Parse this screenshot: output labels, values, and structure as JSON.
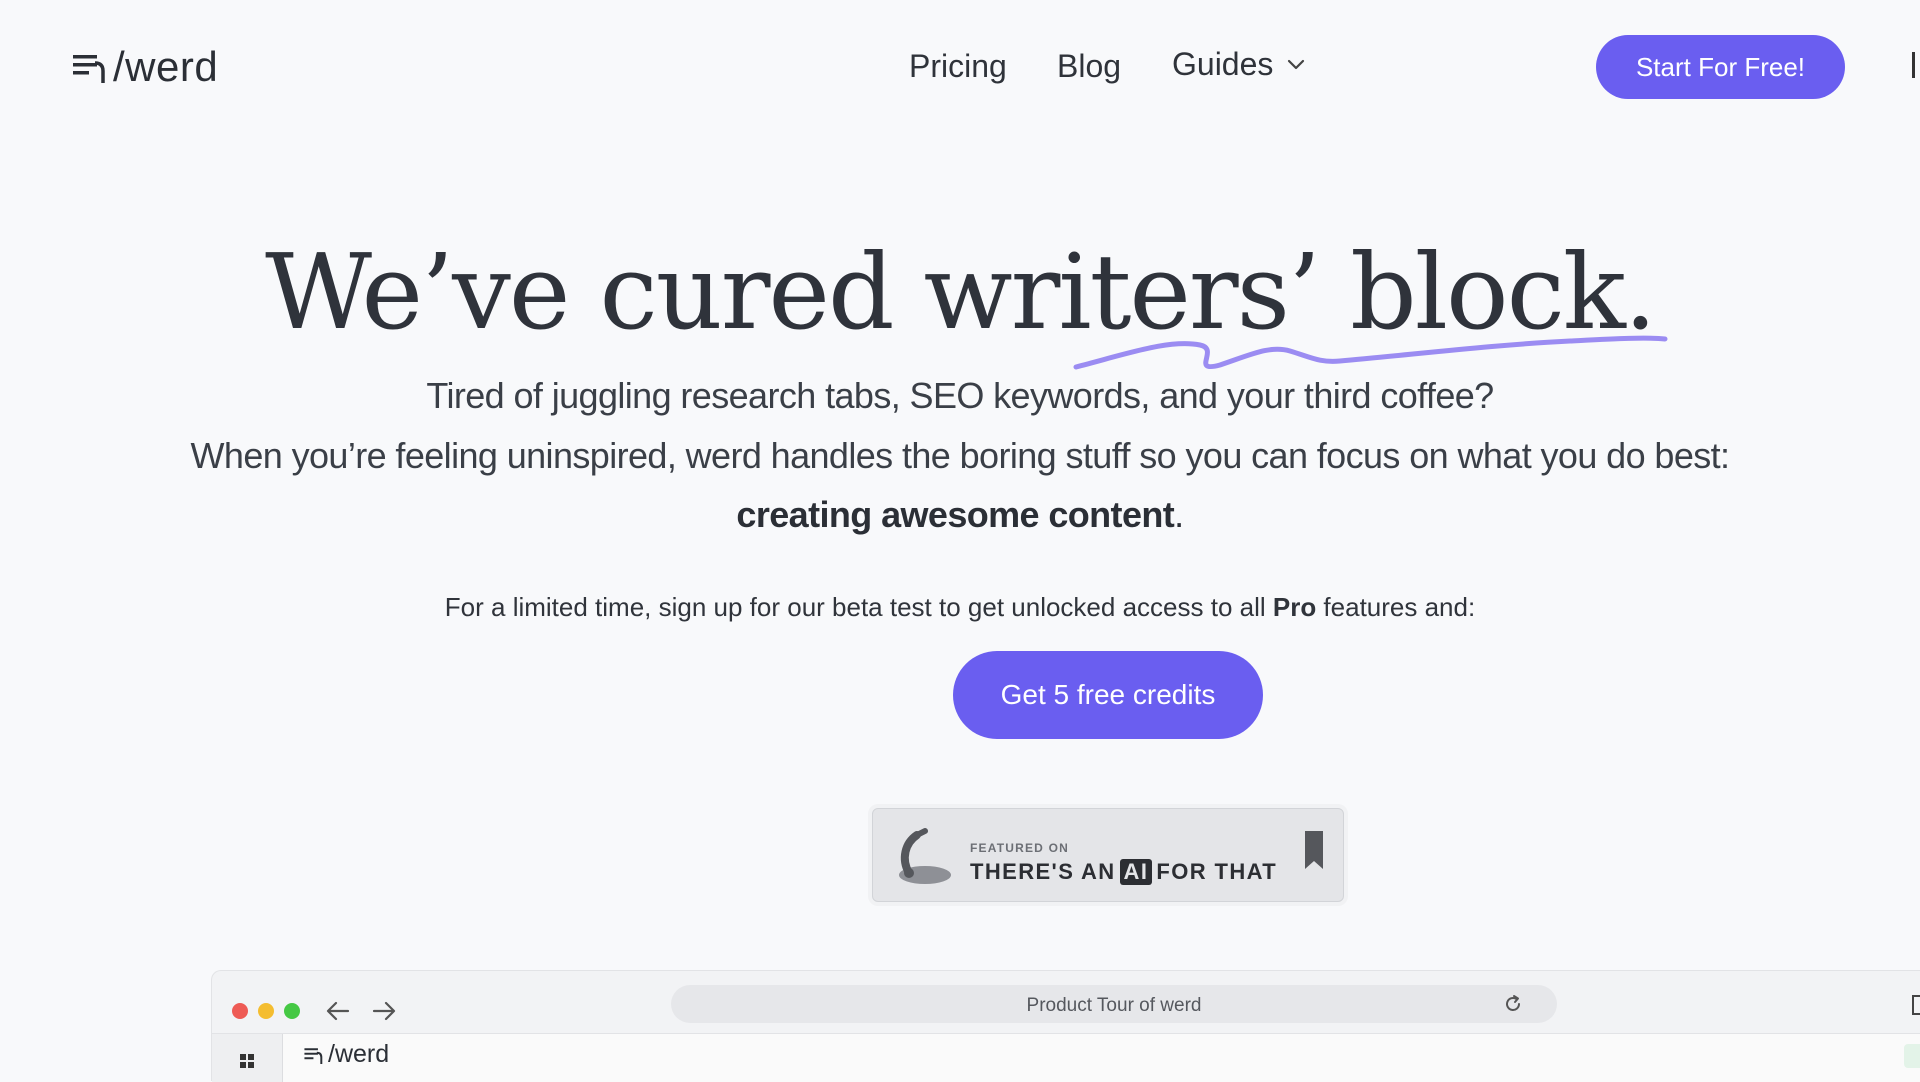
{
  "header": {
    "logo_text": "/werd",
    "nav": {
      "pricing": "Pricing",
      "blog": "Blog",
      "guides": "Guides"
    },
    "cta": "Start For Free!"
  },
  "hero": {
    "headline": "We’ve cured writers’ block.",
    "line1": "Tired of juggling research tabs, SEO keywords, and your third coffee?",
    "line2": "When you’re feeling uninspired, werd handles the boring stuff so you can focus on what you do best:",
    "line3_bold": "creating awesome content",
    "line3_end": ".",
    "promo_before": "For a limited time, sign up for our beta test to get unlocked access to all ",
    "promo_bold": "Pro",
    "promo_after": " features and:",
    "cta": "Get 5 free credits"
  },
  "badge": {
    "small": "FEATURED ON",
    "big_before": "THERE'S AN",
    "big_ai": "AI",
    "big_after": "FOR THAT"
  },
  "browser": {
    "url_title": "Product Tour of werd",
    "app_logo_text": "/werd"
  },
  "colors": {
    "accent": "#6a5ef0",
    "squiggle": "#9b8cf2",
    "background": "#f8f9fb"
  }
}
